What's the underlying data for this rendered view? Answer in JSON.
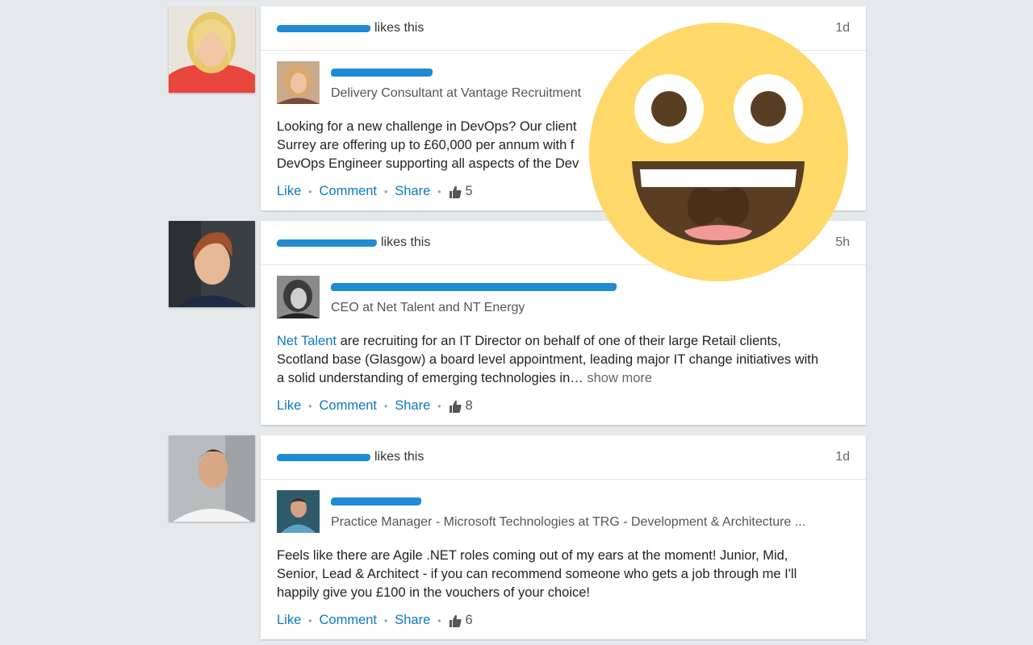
{
  "feed": [
    {
      "liker_action": "likes this",
      "time": "1d",
      "author_headline": "Delivery Consultant at Vantage Recruitment",
      "body_lines": [
        "Looking for a new challenge in DevOps? Our client",
        "Surrey are offering up to £60,000 per annum with f",
        "DevOps Engineer supporting all aspects of the Dev"
      ],
      "actions": {
        "like": "Like",
        "comment": "Comment",
        "share": "Share"
      },
      "like_count": "5"
    },
    {
      "liker_action": "likes this",
      "time": "5h",
      "author_headline": "CEO at Net Talent and NT Energy",
      "body_link": "Net Talent",
      "body_text_1": " are recruiting for an IT Director on behalf of one of their large Retail clients,",
      "body_text_2": "Scotland base (Glasgow) a board level appointment, leading major IT change initiatives with",
      "body_text_3": "a solid understanding of emerging technologies in…",
      "show_more": "show more",
      "actions": {
        "like": "Like",
        "comment": "Comment",
        "share": "Share"
      },
      "like_count": "8"
    },
    {
      "liker_action": "likes this",
      "time": "1d",
      "author_headline": "Practice Manager - Microsoft Technologies at TRG - Development & Architecture ...",
      "body_lines": [
        "Feels like there are Agile .NET roles coming out of my ears at the moment! Junior, Mid,",
        "Senior, Lead & Architect - if you can recommend someone who gets a job through me I'll",
        "happily give you £100 in the vouchers of your choice!"
      ],
      "actions": {
        "like": "Like",
        "comment": "Comment",
        "share": "Share"
      },
      "like_count": "6"
    }
  ],
  "colors": {
    "link_blue": "#0a7ac2",
    "redaction_blue": "#1e8bd2",
    "page_bg": "#e6e9ec",
    "emoji_yellow": "#ffd86a"
  },
  "overlay_icon": "grinning-face-emoji"
}
